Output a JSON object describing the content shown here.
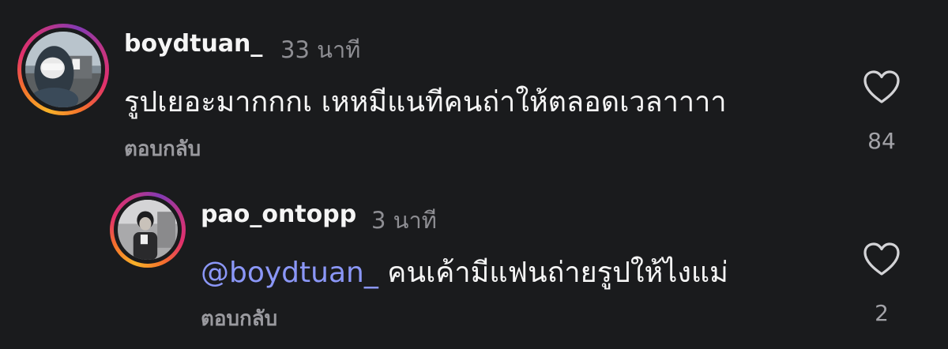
{
  "comments": [
    {
      "username": "boydtuan_",
      "time": "33 นาที",
      "text": "รูปเยอะมากกกเ เหหมีแนทีคนถ่าให้ตลอดเวลาาาา",
      "reply_label": "ตอบกลับ",
      "likes": "84",
      "avatar_icon": "profile-photo"
    }
  ],
  "replies": [
    {
      "username": "pao_ontopp",
      "time": "3 นาที",
      "mention": "@boydtuan_",
      "text": "คนเค้ามีแฟนถ่ายรูปให้ไงแม่",
      "reply_label": "ตอบกลับ",
      "likes": "2",
      "avatar_icon": "profile-photo"
    }
  ],
  "colors": {
    "background": "#1a1b1d",
    "mention": "#8b97f7",
    "secondary_text": "#8e8e93"
  }
}
